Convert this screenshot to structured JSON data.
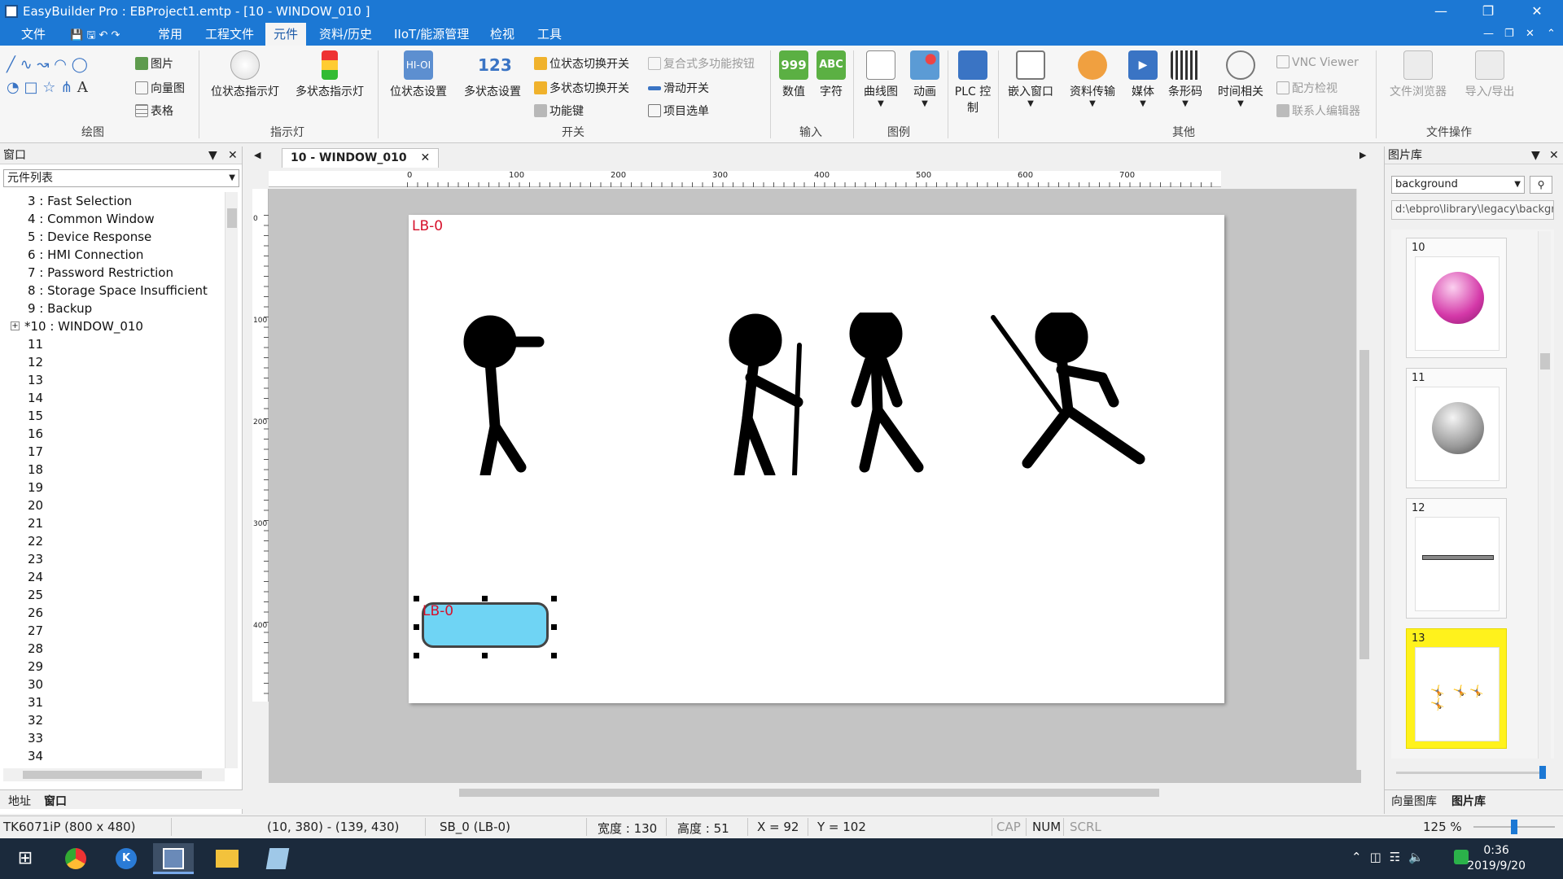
{
  "titlebar": {
    "title": "EasyBuilder Pro : EBProject1.emtp - [10 - WINDOW_010 ]"
  },
  "menu": [
    "文件",
    "常用",
    "工程文件",
    "元件",
    "资料/历史",
    "IIoT/能源管理",
    "检视",
    "工具"
  ],
  "ribbon": {
    "draw": {
      "label": "绘图",
      "picture": "图片",
      "vector": "向量图",
      "table": "表格"
    },
    "indicator": {
      "label": "指示灯",
      "bit_lamp": "位状态指示灯",
      "multi_lamp": "多状态指示灯"
    },
    "switch": {
      "label": "开关",
      "bit_set": "位状态设置",
      "word_set": "多状态设置",
      "bit_toggle": "位状态切换开关",
      "multi_toggle": "多状态切换开关",
      "function_key": "功能键",
      "combo_button": "复合式多功能按钮",
      "slide_switch": "滑动开关",
      "item_list": "项目选单"
    },
    "input": {
      "label": "输入",
      "numeric": "数值",
      "numeric_icon": "999",
      "ascii": "字符",
      "ascii_icon": "ABC"
    },
    "chart": {
      "label": "图例",
      "trend": "曲线图",
      "animation": "动画"
    },
    "plc": {
      "plc_control_1": "PLC 控",
      "plc_control_2": "制"
    },
    "other": {
      "label": "其他",
      "embed_window": "嵌入窗口",
      "data_transfer": "资料传输",
      "media": "媒体",
      "barcode": "条形码",
      "time": "时间相关",
      "vnc": "VNC Viewer",
      "recipe": "配方检视",
      "contact_editor": "联系人编辑器"
    },
    "file_ops": {
      "label": "文件操作",
      "file_browser": "文件浏览器",
      "import_export": "导入/导出"
    }
  },
  "left_panel": {
    "title": "窗口",
    "combo": "元件列表",
    "items": [
      "3 : Fast Selection",
      "4 : Common Window",
      "5 : Device Response",
      "6 : HMI Connection",
      "7 : Password Restriction",
      "8 : Storage Space Insufficient",
      "9 : Backup",
      "*10 : WINDOW_010",
      "11",
      "12",
      "13",
      "14",
      "15",
      "16",
      "17",
      "18",
      "19",
      "20",
      "21",
      "22",
      "23",
      "24",
      "25",
      "26",
      "27",
      "28",
      "29",
      "30",
      "31",
      "32",
      "33",
      "34"
    ],
    "tabs": [
      "地址",
      "窗口"
    ]
  },
  "editor": {
    "tab": "10 - WINDOW_010",
    "canvas_label": "LB-0",
    "button_label": "LB-0",
    "ruler_marks": [
      "0",
      "100",
      "200",
      "300",
      "400",
      "500",
      "600",
      "700"
    ],
    "vruler_marks": [
      "0",
      "100",
      "200",
      "300",
      "400"
    ]
  },
  "right_panel": {
    "title": "图片库",
    "library": "background",
    "path": "d:\\ebpro\\library\\legacy\\backgroun",
    "thumbs": [
      "10",
      "11",
      "12",
      "13"
    ],
    "tabs": [
      "向量图库",
      "图片库"
    ]
  },
  "statusbar": {
    "model": "TK6071iP (800 x 480)",
    "coords": "(10, 380) - (139, 430)",
    "object": "SB_0 (LB-0)",
    "width": "宽度 : 130",
    "height": "高度 :  51",
    "x": "X = 92",
    "y": "Y = 102",
    "cap": "CAP",
    "num": "NUM",
    "scrl": "SCRL",
    "zoom": "125 %"
  },
  "taskbar": {
    "time": "0:36",
    "date": "2019/9/20"
  },
  "colors": {
    "accent": "#1c78d4",
    "selected_thumb": "#fff21c",
    "button_fill": "#6fd4f4",
    "label_red": "#d6102a"
  }
}
